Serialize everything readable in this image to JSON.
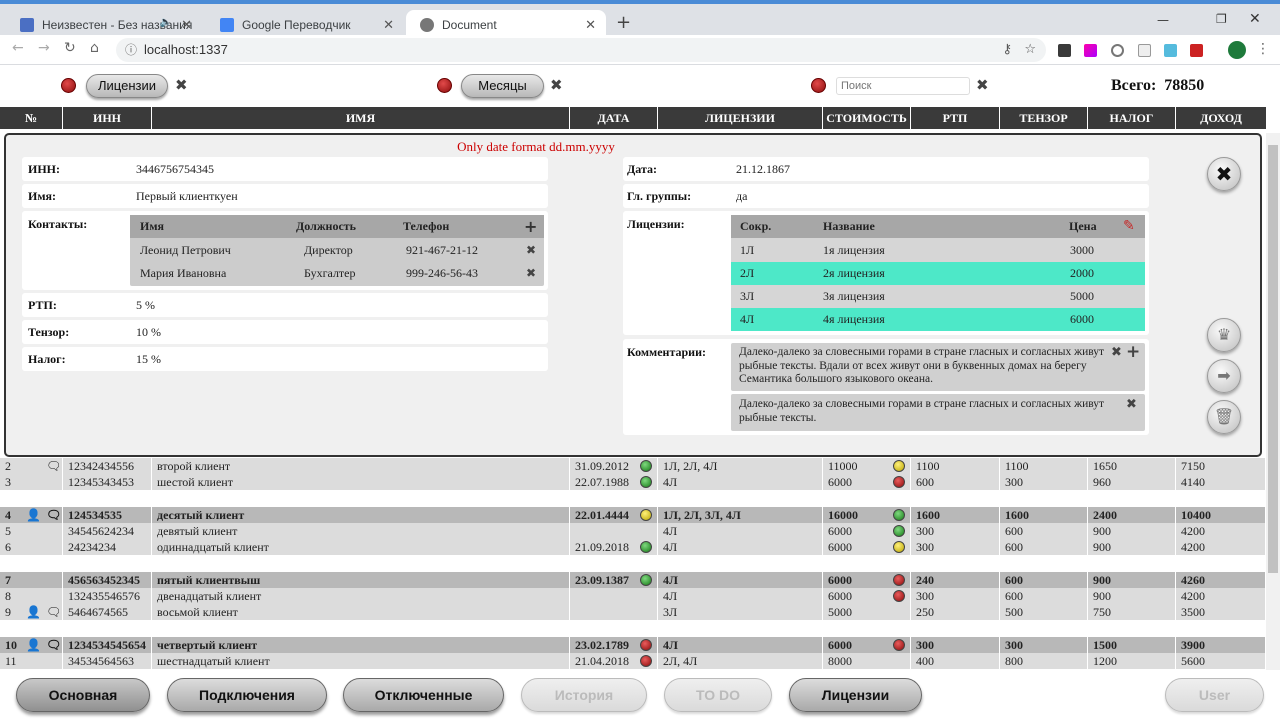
{
  "browser": {
    "tabs": [
      {
        "title": "Неизвестен - Без названия"
      },
      {
        "title": "Google Переводчик"
      },
      {
        "title": "Document"
      }
    ],
    "url": "localhost:1337"
  },
  "toolbar": {
    "licenses_btn": "Лицензии",
    "months_btn": "Месяцы",
    "search_placeholder": "Поиск",
    "total_label": "Всего:",
    "total_value": "78850"
  },
  "columns": [
    "№",
    "ИНН",
    "ИМЯ",
    "ДАТА",
    "ЛИЦЕНЗИИ",
    "СТОИМОСТЬ",
    "РТП",
    "ТЕНЗОР",
    "НАЛОГ",
    "ДОХОД"
  ],
  "detail": {
    "error": "Only date format dd.mm.yyyy",
    "inn_label": "ИНН:",
    "inn": "3446756754345",
    "name_label": "Имя:",
    "name": "Первый клиенткуен",
    "contacts_label": "Контакты:",
    "contacts_head": {
      "name": "Имя",
      "position": "Должность",
      "phone": "Телефон"
    },
    "contacts": [
      {
        "name": "Леонид Петрович",
        "position": "Директор",
        "phone": "921-467-21-12"
      },
      {
        "name": "Мария Ивановна",
        "position": "Бухгалтер",
        "phone": "999-246-56-43"
      }
    ],
    "rtp_label": "РТП:",
    "rtp": "5 %",
    "tensor_label": "Тензор:",
    "tensor": "10 %",
    "tax_label": "Налог:",
    "tax": "15 %",
    "date_label": "Дата:",
    "date": "21.12.1867",
    "group_label": "Гл. группы:",
    "group": "да",
    "licenses_label": "Лицензии:",
    "lic_head": {
      "short": "Сокр.",
      "name": "Название",
      "price": "Цена"
    },
    "licenses": [
      {
        "short": "1Л",
        "name": "1я лицензия",
        "price": "3000",
        "selected": false
      },
      {
        "short": "2Л",
        "name": "2я лицензия",
        "price": "2000",
        "selected": true
      },
      {
        "short": "3Л",
        "name": "3я лицензия",
        "price": "5000",
        "selected": false
      },
      {
        "short": "4Л",
        "name": "4я лицензия",
        "price": "6000",
        "selected": true
      }
    ],
    "comments_label": "Комментарии:",
    "comments": [
      "Далеко-далеко за словесными горами в стране гласных и согласных живут рыбные тексты. Вдали от всех живут они в буквенных домах на берегу Семантика большого языкового океана.",
      "Далеко-далеко за словесными горами в стране гласных и согласных живут рыбные тексты."
    ]
  },
  "rows": [
    {
      "n": "2",
      "inn": "12342434556",
      "name": "второй клиент",
      "date": "31.09.2012",
      "dot1": "g",
      "lic": "1Л, 2Л, 4Л",
      "cost": "11000",
      "dot2": "y",
      "rtp": "1100",
      "tensor": "1100",
      "tax": "1650",
      "income": "7150",
      "bold": false,
      "user": false,
      "msg": true,
      "bg": "#dcdcdc"
    },
    {
      "n": "3",
      "inn": "12345343453",
      "name": "шестой клиент",
      "date": "22.07.1988",
      "dot1": "g",
      "lic": "4Л",
      "cost": "6000",
      "dot2": "r",
      "rtp": "600",
      "tensor": "300",
      "tax": "960",
      "income": "4140",
      "bold": false,
      "user": false,
      "msg": false,
      "bg": "#dcdcdc"
    },
    {
      "n": "4",
      "inn": "124534535",
      "name": "десятый клиент",
      "date": "22.01.4444",
      "dot1": "y",
      "lic": "1Л, 2Л, 3Л, 4Л",
      "cost": "16000",
      "dot2": "g",
      "rtp": "1600",
      "tensor": "1600",
      "tax": "2400",
      "income": "10400",
      "bold": true,
      "user": true,
      "msg": true,
      "bg": "#b8b8b8"
    },
    {
      "n": "5",
      "inn": "34545624234",
      "name": "девятый клиент",
      "date": "",
      "dot1": "",
      "lic": "4Л",
      "cost": "6000",
      "dot2": "g",
      "rtp": "300",
      "tensor": "600",
      "tax": "900",
      "income": "4200",
      "bold": false,
      "user": false,
      "msg": false,
      "bg": "#dcdcdc"
    },
    {
      "n": "6",
      "inn": "24234234",
      "name": "одиннадцатый клиент",
      "date": "21.09.2018",
      "dot1": "g",
      "lic": "4Л",
      "cost": "6000",
      "dot2": "y",
      "rtp": "300",
      "tensor": "600",
      "tax": "900",
      "income": "4200",
      "bold": false,
      "user": false,
      "msg": false,
      "bg": "#dcdcdc"
    },
    {
      "n": "7",
      "inn": "456563452345",
      "name": "пятый клиентвыш",
      "date": "23.09.1387",
      "dot1": "g",
      "lic": "4Л",
      "cost": "6000",
      "dot2": "r",
      "rtp": "240",
      "tensor": "600",
      "tax": "900",
      "income": "4260",
      "bold": true,
      "user": false,
      "msg": false,
      "bg": "#b8b8b8"
    },
    {
      "n": "8",
      "inn": "132435546576",
      "name": "двенадцатый клиент",
      "date": "",
      "dot1": "",
      "lic": "4Л",
      "cost": "6000",
      "dot2": "r",
      "rtp": "300",
      "tensor": "600",
      "tax": "900",
      "income": "4200",
      "bold": false,
      "user": false,
      "msg": false,
      "bg": "#dcdcdc"
    },
    {
      "n": "9",
      "inn": "5464674565",
      "name": "восьмой клиент",
      "date": "",
      "dot1": "",
      "lic": "3Л",
      "cost": "5000",
      "dot2": "",
      "rtp": "250",
      "tensor": "500",
      "tax": "750",
      "income": "3500",
      "bold": false,
      "user": true,
      "msg": true,
      "bg": "#dcdcdc"
    },
    {
      "n": "10",
      "inn": "1234534545654",
      "name": "четвертый клиент",
      "date": "23.02.1789",
      "dot1": "r",
      "lic": "4Л",
      "cost": "6000",
      "dot2": "r",
      "rtp": "300",
      "tensor": "300",
      "tax": "1500",
      "income": "3900",
      "bold": true,
      "user": true,
      "msg": true,
      "bg": "#b8b8b8"
    },
    {
      "n": "11",
      "inn": "34534564563",
      "name": "шестнадцатый клиент",
      "date": "21.04.2018",
      "dot1": "r",
      "lic": "2Л, 4Л",
      "cost": "8000",
      "dot2": "",
      "rtp": "400",
      "tensor": "800",
      "tax": "1200",
      "income": "5600",
      "bold": false,
      "user": false,
      "msg": false,
      "bg": "#dcdcdc"
    }
  ],
  "footer": {
    "main": "Основная",
    "connections": "Подключения",
    "disconnected": "Отключенные",
    "history": "История",
    "todo": "TO DO",
    "licenses": "Лицензии",
    "user": "User"
  },
  "colors": {
    "selected_row": "#4de8c8",
    "error": "#cc0000",
    "header": "#3a3a3a"
  }
}
